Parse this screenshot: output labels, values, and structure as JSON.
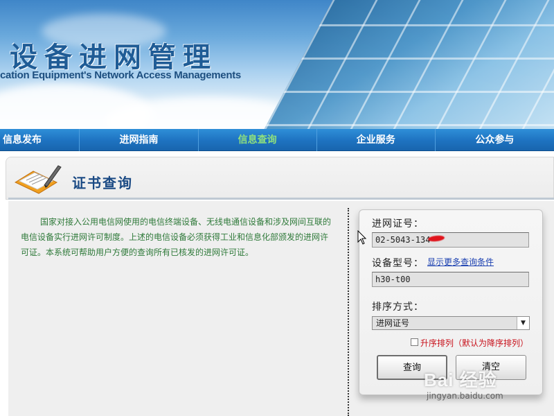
{
  "banner": {
    "title": "设备进网管理",
    "subtitle": "cation Equipment's Network Access Managements"
  },
  "nav": {
    "items": [
      {
        "label": "信息发布"
      },
      {
        "label": "进网指南"
      },
      {
        "label": "信息查询",
        "active": true
      },
      {
        "label": "企业服务"
      },
      {
        "label": "公众参与"
      }
    ],
    "active_color": "#8fe07d"
  },
  "section": {
    "title": "证书查询",
    "icon": "certificate-pen-icon"
  },
  "description": "国家对接入公用电信网使用的电信终端设备、无线电通信设备和涉及网间互联的电信设备实行进网许可制度。上述的电信设备必须获得工业和信息化部颁发的进网许可证。本系统可帮助用户方便的查询所有已核发的进网许可证。",
  "form": {
    "cert_label": "进网证号：",
    "cert_value": "02-5043-134",
    "model_label": "设备型号：",
    "more_link": "显示更多查询条件",
    "model_value": "h30-t00",
    "sort_label": "排序方式：",
    "sort_selected": "进网证号",
    "ascending_label": "升序排列（默认为降序排列）",
    "ascending_checked": false,
    "query_button": "查询",
    "clear_button": "清空"
  },
  "watermark": {
    "logo": "Bai 经验",
    "url": "jingyan.baidu.com"
  },
  "colors": {
    "nav_blue": "#1e72c0",
    "title_blue": "#1b4a84",
    "description_green": "#2f7a3a",
    "link_blue": "#1a3fb0",
    "checkbox_label_red": "#c8101a"
  }
}
